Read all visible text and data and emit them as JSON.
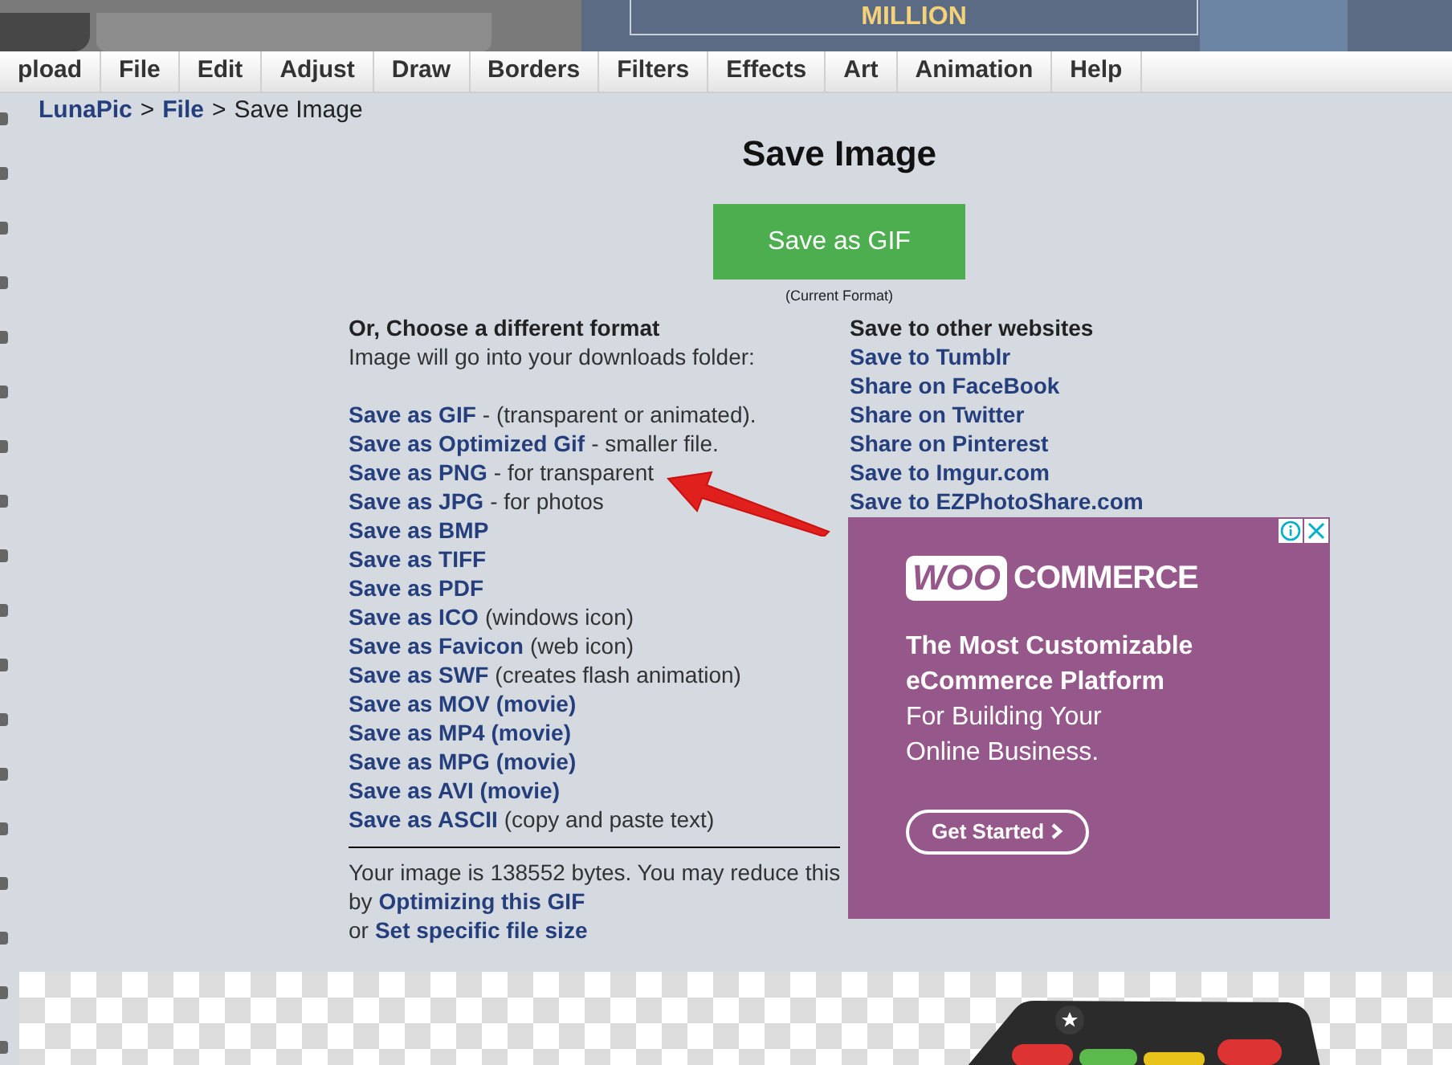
{
  "banner": {
    "text": "MILLION"
  },
  "menu": [
    {
      "label": "pload"
    },
    {
      "label": "File"
    },
    {
      "label": "Edit"
    },
    {
      "label": "Adjust"
    },
    {
      "label": "Draw"
    },
    {
      "label": "Borders"
    },
    {
      "label": "Filters"
    },
    {
      "label": "Effects"
    },
    {
      "label": "Art"
    },
    {
      "label": "Animation"
    },
    {
      "label": "Help"
    }
  ],
  "breadcrumb": [
    {
      "label": "LunaPic",
      "kind": "link"
    },
    {
      "label": ">",
      "kind": "separator"
    },
    {
      "label": "File",
      "kind": "link"
    },
    {
      "label": ">",
      "kind": "separator"
    },
    {
      "label": "Save Image",
      "kind": "current"
    }
  ],
  "title": "Save Image",
  "primary_button": {
    "label": "Save as GIF"
  },
  "current_format_note": "(Current Format)",
  "formats": {
    "heading": "Or, Choose a different format",
    "subheading": "Image will go into your downloads folder:",
    "items": [
      {
        "link": "Save as GIF",
        "note": "- (transparent or animated)."
      },
      {
        "link": "Save as Optimized Gif",
        "note": "- smaller file."
      },
      {
        "link": "Save as PNG",
        "note": "- for transparent"
      },
      {
        "link": "Save as JPG",
        "note": "- for photos"
      },
      {
        "link": "Save as BMP"
      },
      {
        "link": "Save as TIFF"
      },
      {
        "link": "Save as PDF"
      },
      {
        "link": "Save as ICO",
        "note": "(windows icon)"
      },
      {
        "link": "Save as Favicon",
        "note": "(web icon)"
      },
      {
        "link": "Save as SWF",
        "note": "(creates flash animation)"
      },
      {
        "link": "Save as MOV (movie)"
      },
      {
        "link": "Save as MP4 (movie)"
      },
      {
        "link": "Save as MPG (movie)"
      },
      {
        "link": "Save as AVI (movie)"
      },
      {
        "link": "Save as ASCII",
        "note": "(copy and paste text)"
      }
    ]
  },
  "size_note": {
    "text": "Your image is 138552 bytes. You may reduce this",
    "prefix_1": "by",
    "link_1": "Optimizing this GIF",
    "prefix_2": "or",
    "link_2": "Set specific file size"
  },
  "share": {
    "heading": "Save to other websites",
    "links": [
      "Save to Tumblr",
      "Share on FaceBook",
      "Share on Twitter",
      "Share on Pinterest",
      "Save to Imgur.com",
      "Save to EZPhotoShare.com"
    ]
  },
  "ad": {
    "logo_badge": "WOO",
    "logo_text": "COMMERCE",
    "headline": "The Most Customizable eCommerce Platform",
    "body": "For Building Your Online Business.",
    "button": "Get Started"
  }
}
